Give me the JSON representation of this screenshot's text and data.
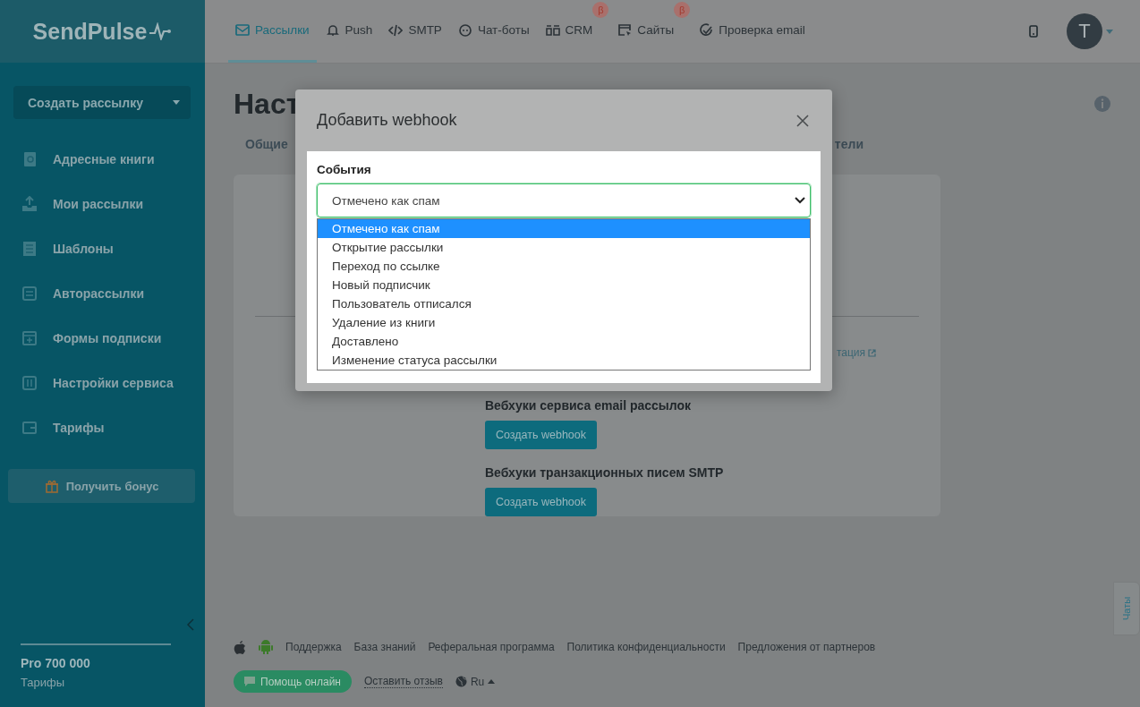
{
  "logo": {
    "text": "SendPulse"
  },
  "sidebar": {
    "create_button": "Создать рассылку",
    "items": [
      {
        "label": "Адресные книги",
        "kind": "book"
      },
      {
        "label": "Мои рассылки",
        "kind": "send"
      },
      {
        "label": "Шаблоны",
        "kind": "template"
      },
      {
        "label": "Авторассылки",
        "kind": "flow"
      },
      {
        "label": "Формы подписки",
        "kind": "form"
      },
      {
        "label": "Настройки сервиса",
        "kind": "settings"
      },
      {
        "label": "Тарифы",
        "kind": "wallet"
      }
    ],
    "bonus_button": "Получить бонус",
    "plan": "Pro 700 000",
    "plan_link": "Тарифы"
  },
  "nav": {
    "tabs": [
      {
        "label": "Рассылки",
        "selected": true,
        "kind": "mail"
      },
      {
        "label": "Push",
        "selected": false,
        "kind": "bell"
      },
      {
        "label": "SMTP",
        "selected": false,
        "kind": "code"
      },
      {
        "label": "Чат-боты",
        "selected": false,
        "kind": "chat"
      },
      {
        "label": "CRM",
        "selected": false,
        "kind": "crm",
        "badge": "β"
      },
      {
        "label": "Сайты",
        "selected": false,
        "kind": "site",
        "badge": "β"
      },
      {
        "label": "Проверка email",
        "selected": false,
        "kind": "check"
      }
    ],
    "avatar": "T"
  },
  "page": {
    "title": "Наст",
    "tabs": [
      "Общие",
      "тели"
    ],
    "docs_link": "тация",
    "sections": [
      {
        "heading": "Вебхуки сервиса email рассылок",
        "button": "Создать webhook"
      },
      {
        "heading": "Вебхуки транзакционных писем SMTP",
        "button": "Создать webhook"
      }
    ]
  },
  "footer": {
    "links": [
      "Поддержка",
      "База знаний",
      "Реферальная программа",
      "Политика конфиденциальности",
      "Предложения от партнеров"
    ],
    "help_button": "Помощь онлайн",
    "feedback_link": "Оставить отзыв",
    "language": "Ru"
  },
  "chat_tab": "Чаты",
  "modal": {
    "title": "Добавить webhook",
    "field_label": "События",
    "value": "Отмечено как спам",
    "options": [
      {
        "label": "Отмечено как спам",
        "selected": true
      },
      {
        "label": "Открытие рассылки",
        "selected": false
      },
      {
        "label": "Переход по ссылке",
        "selected": false
      },
      {
        "label": "Новый подписчик",
        "selected": false
      },
      {
        "label": "Пользователь отписался",
        "selected": false
      },
      {
        "label": "Удаление из книги",
        "selected": false
      },
      {
        "label": "Доставлено",
        "selected": false
      },
      {
        "label": "Изменение статуса рассылки",
        "selected": false
      }
    ]
  }
}
